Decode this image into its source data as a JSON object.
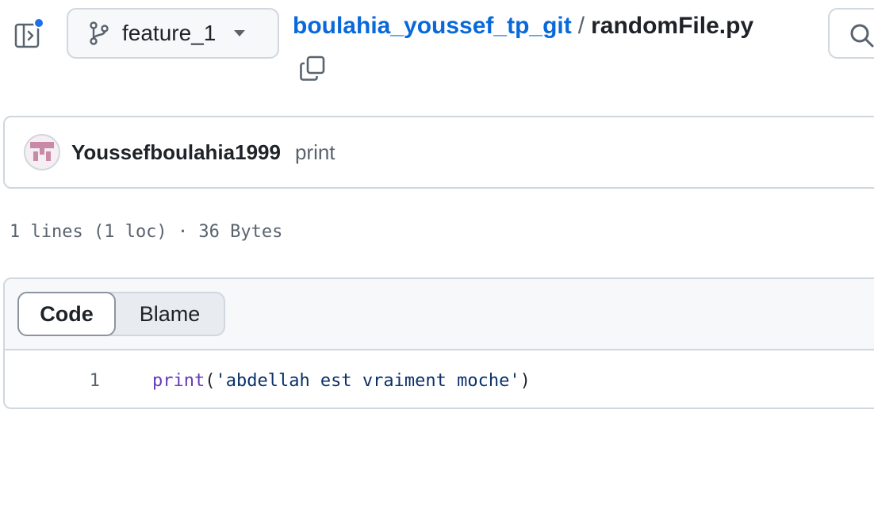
{
  "header": {
    "panel_toggle_icon": "sidebar-expand-icon",
    "notification_color": "#1f6feb",
    "branch": {
      "icon": "git-branch-icon",
      "name": "feature_1",
      "caret_icon": "triangle-down-icon"
    },
    "breadcrumb": {
      "repo": "boulahia_youssef_tp_git",
      "separator": "/",
      "file": "randomFile.py"
    },
    "copy_icon": "copy-icon",
    "search_icon": "search-icon"
  },
  "commit": {
    "author": "Youssefboulahia1999",
    "message": "print"
  },
  "file_meta": "1 lines (1 loc) · 36 Bytes",
  "viewer": {
    "tabs": [
      {
        "label": "Code",
        "active": true
      },
      {
        "label": "Blame",
        "active": false
      }
    ]
  },
  "code": {
    "lines": [
      {
        "number": "1",
        "fn": "print",
        "open": "(",
        "string": "'abdellah est vraiment moche'",
        "close": ")"
      }
    ]
  },
  "colors": {
    "link": "#0969da",
    "border": "#d0d7de",
    "muted": "#59636e",
    "fn": "#6639ba",
    "string": "#0a3069"
  }
}
